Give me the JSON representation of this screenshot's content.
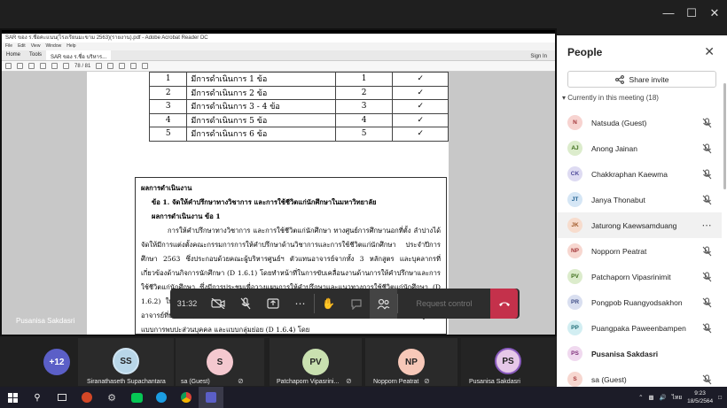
{
  "window": {
    "controls": [
      "minimize",
      "restore",
      "close"
    ]
  },
  "acrobat": {
    "title": "SAR ของ ร.ชื่อคะแนน(โรงเรียนมะขาม 2563)(รายงาน).pdf - Adobe Acrobat Reader DC",
    "menu": [
      "File",
      "Edit",
      "View",
      "Window",
      "Help"
    ],
    "tabs": [
      "Home",
      "Tools",
      "SAR ของ ร.ชื่อ บริหาร..."
    ],
    "sign_in": "Sign In",
    "page_num": "78 / 81"
  },
  "doc": {
    "rows": [
      {
        "n": "1",
        "desc": "มีการดำเนินการ 1 ข้อ",
        "score": "1",
        "check": "✓"
      },
      {
        "n": "2",
        "desc": "มีการดำเนินการ 2 ข้อ",
        "score": "2",
        "check": "✓"
      },
      {
        "n": "3",
        "desc": "มีการดำเนินการ 3 - 4 ข้อ",
        "score": "3",
        "check": "✓"
      },
      {
        "n": "4",
        "desc": "มีการดำเนินการ 5 ข้อ",
        "score": "4",
        "check": "✓"
      },
      {
        "n": "5",
        "desc": "มีการดำเนินการ 6 ข้อ",
        "score": "5",
        "check": "✓"
      }
    ],
    "result_heading": "ผลการดำเนินงาน",
    "item_line": "ข้อ 1. จัดให้คำปรึกษาทางวิชาการ และการใช้ชีวิตแก่นักศึกษาในมหาวิทยาลัย",
    "item_result": "ผลการดำเนินงาน ข้อ 1",
    "paragraph": "การให้คำปรึกษาทางวิชาการ และการใช้ชีวิตแก่นักศึกษา ทางศูนย์การศึกษานอกที่ตั้ง ลำปางได้จัดให้มีการแต่งตั้งคณะกรรมการการให้คำปรึกษาด้านวิชาการและการใช้ชีวิตแก่นักศึกษา ประจำปีการศึกษา 2563 ซึ่งประกอบด้วยคณะผู้บริหารศูนย์ฯ ตัวแทนอาจารย์จากทั้ง 3 หลักสูตร และบุคลากรที่เกี่ยวข้องด้านกิจการนักศึกษา (D 1.6.1) โดยทำหน้าที่ในการขับเคลื่อนงานด้านการให้คำปรึกษาและการใช้ชีวิตแก่นักศึกษา ซึ่งมีการประชุมเพื่อวางแผนการให้คำปรึกษาและแนวทางการใช้ชีวิตแก่นักศึกษา (D 1.6.2) ให้สอดคล้องกับคู่มืออาจารย์ที่ปรึกษาในการประชุมประจำเดือนกรกฎาคม 2563 พร้อมคัดเลือกอาจารย์ที่ปรึกษา (D 1.6.3) และจัดให้มีตารางเวลาการให้คำปรึกษาแก่นักศึกษาร่วมกับทั้ง 3 หลักสูตรทั้งแบบการพบปะส่วนบุคคล และแบบกลุ่มย่อย (D 1.6.4) โดย"
  },
  "presenter_name": "Pusanisa Sakdasri",
  "toolbar": {
    "time": "31:32",
    "request_control": "Request control"
  },
  "gallery": [
    {
      "initials": "+12",
      "name": "",
      "color": "#5b5fc7",
      "muted": false
    },
    {
      "initials": "SS",
      "name": "Siranathaseth Supachantara",
      "color": "#b8d6e8",
      "muted": false
    },
    {
      "initials": "S",
      "name": "sa (Guest)",
      "color": "#f4c8cf",
      "muted": true
    },
    {
      "initials": "PV",
      "name": "Patchaporn Vipasrini...",
      "color": "#c9e0b0",
      "muted": true
    },
    {
      "initials": "NP",
      "name": "Nopporn Peatrat",
      "color": "#f7c8b8",
      "muted": true
    },
    {
      "initials": "PS",
      "name": "Pusanisa Sakdasri",
      "color": "#e6c8e8",
      "muted": false
    }
  ],
  "people": {
    "title": "People",
    "share_invite": "Share invite",
    "section": "Currently in this meeting (18)",
    "members": [
      {
        "initials": "N",
        "name": "Natsuda (Guest)",
        "bg": "#f7d3d0",
        "fg": "#a4373a",
        "muted": true
      },
      {
        "initials": "AJ",
        "name": "Anong Jainan",
        "bg": "#dceccc",
        "fg": "#3b6b18",
        "muted": true
      },
      {
        "initials": "CK",
        "name": "Chakkraphan Kaewma",
        "bg": "#dedbf2",
        "fg": "#4f4a9a",
        "muted": true
      },
      {
        "initials": "JT",
        "name": "Janya Thonabut",
        "bg": "#d5e6f5",
        "fg": "#1d5e8f",
        "muted": true
      },
      {
        "initials": "JK",
        "name": "Jaturong Kaewsamduang",
        "bg": "#f7dccd",
        "fg": "#a15a2a",
        "muted": false
      },
      {
        "initials": "NP",
        "name": "Nopporn Peatrat",
        "bg": "#f7d7d0",
        "fg": "#a4373a",
        "muted": true
      },
      {
        "initials": "PV",
        "name": "Patchaporn Vipasrinimit",
        "bg": "#dceccc",
        "fg": "#3b6b18",
        "muted": true
      },
      {
        "initials": "PR",
        "name": "Pongpob Ruangyodsakhon",
        "bg": "#d9dff0",
        "fg": "#3f4e87",
        "muted": true
      },
      {
        "initials": "PP",
        "name": "Puangpaka Paweenbampen",
        "bg": "#d2eef2",
        "fg": "#1c6b75",
        "muted": true
      },
      {
        "initials": "PS",
        "name": "Pusanisa Sakdasri",
        "bg": "#f0d9ef",
        "fg": "#7e2f7a",
        "muted": false,
        "me": true
      },
      {
        "initials": "S",
        "name": "sa (Guest)",
        "bg": "#f7d7d0",
        "fg": "#a4373a",
        "muted": true
      }
    ]
  },
  "tray": {
    "time": "9:23",
    "date": "18/5/2564",
    "lang": "ไทย"
  }
}
